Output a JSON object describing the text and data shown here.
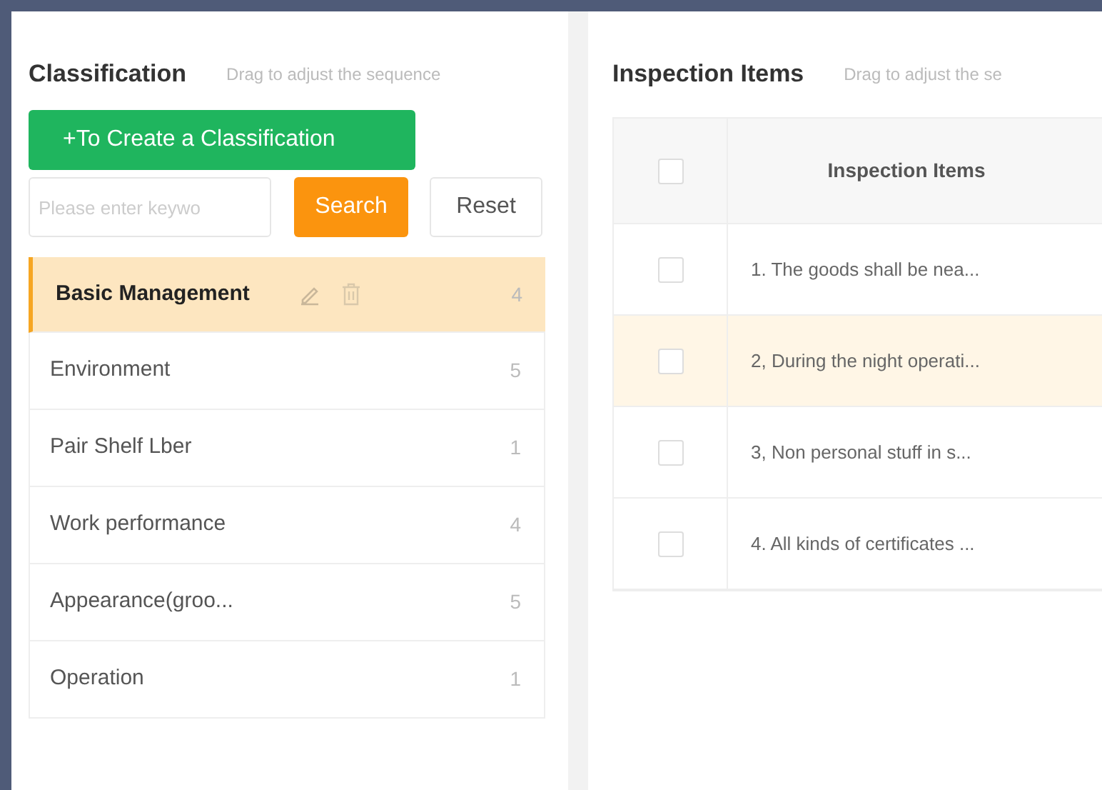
{
  "classification_panel": {
    "title": "Classification",
    "hint": "Drag to adjust the sequence",
    "create_button": "+To Create a Classification",
    "search": {
      "placeholder": "Please enter keywo"
    },
    "search_button": "Search",
    "reset_button": "Reset",
    "items": [
      {
        "label": "Basic Management",
        "count": "4",
        "selected": true
      },
      {
        "label": "Environment",
        "count": "5",
        "selected": false
      },
      {
        "label": "Pair Shelf Lber",
        "count": "1",
        "selected": false
      },
      {
        "label": "Work performance",
        "count": "4",
        "selected": false
      },
      {
        "label": "Appearance(groo...",
        "count": "5",
        "selected": false
      },
      {
        "label": "Operation",
        "count": "1",
        "selected": false
      }
    ]
  },
  "inspection_panel": {
    "title": "Inspection Items",
    "hint": "Drag to adjust the se",
    "table": {
      "header_checked": false,
      "columns": [
        "Inspection Items"
      ],
      "rows": [
        {
          "text": "1. The goods shall be nea...",
          "checked": false,
          "selected": false
        },
        {
          "text": "2, During the night operati...",
          "checked": false,
          "selected": true
        },
        {
          "text": "3, Non personal stuff in s...",
          "checked": false,
          "selected": false
        },
        {
          "text": "4. All kinds of certificates ...",
          "checked": false,
          "selected": false
        }
      ]
    }
  }
}
